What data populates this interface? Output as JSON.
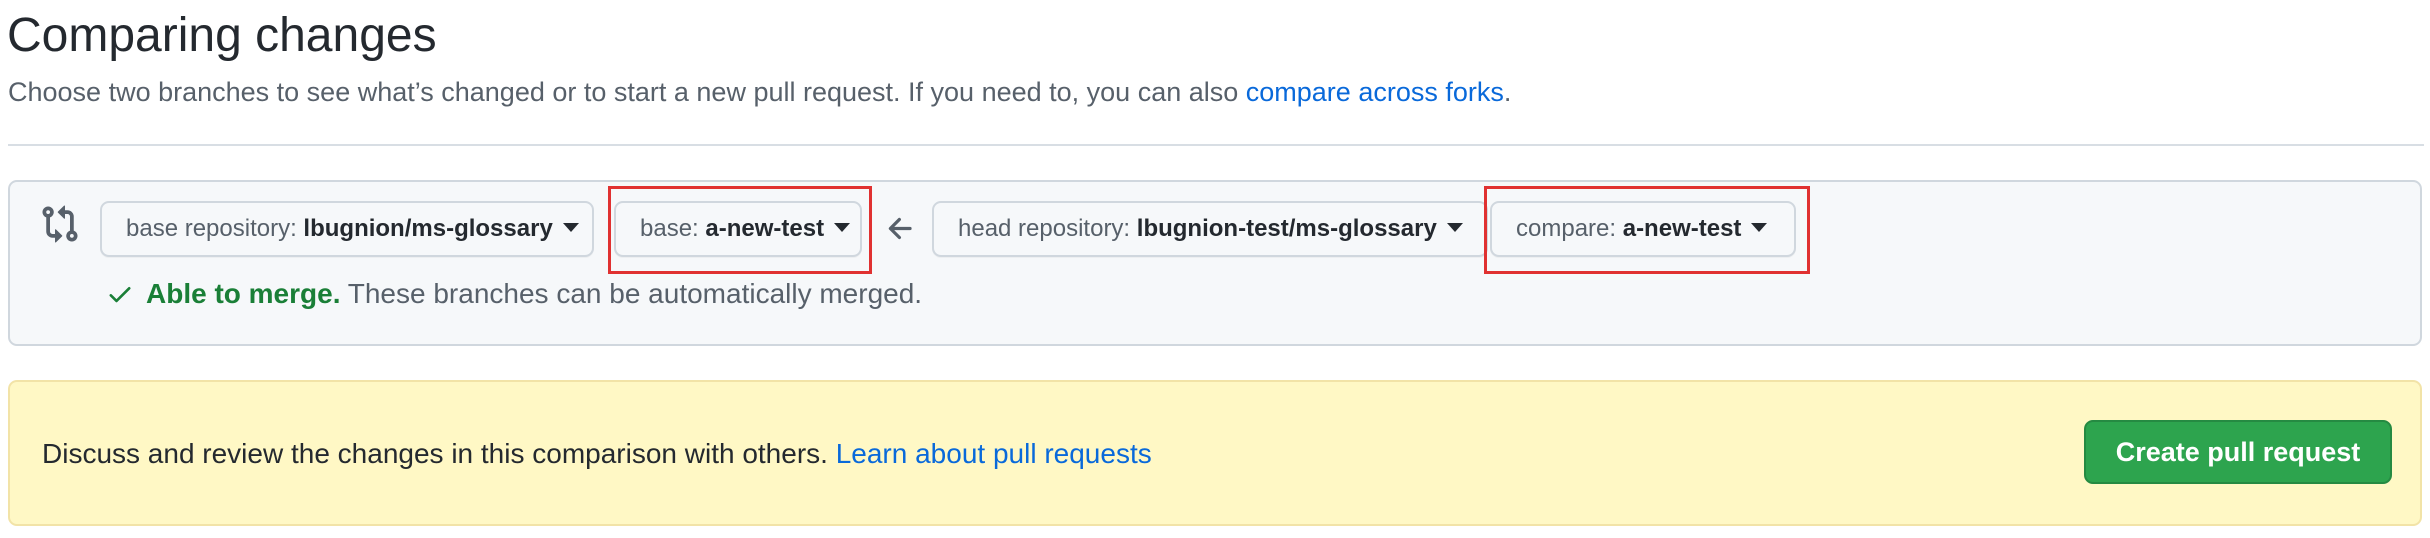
{
  "header": {
    "title": "Comparing changes",
    "subtitle_text": "Choose two branches to see what’s changed or to start a new pull request. If you need to, you can also ",
    "subtitle_link": "compare across forks",
    "subtitle_end": "."
  },
  "range": {
    "base_repo": {
      "label": "base repository: ",
      "value": "lbugnion/ms-glossary"
    },
    "base_branch": {
      "label": "base: ",
      "value": "a-new-test"
    },
    "head_repo": {
      "label": "head repository: ",
      "value": "lbugnion-test/ms-glossary"
    },
    "compare_branch": {
      "label": "compare: ",
      "value": "a-new-test"
    },
    "merge_ok": "Able to merge.",
    "merge_detail": " These branches can be automatically merged."
  },
  "flash": {
    "text": "Discuss and review the changes in this comparison with others. ",
    "link": "Learn about pull requests",
    "button": "Create pull request"
  },
  "colors": {
    "link": "#0969da",
    "success": "#1a7f37",
    "button_bg": "#2da44e",
    "flash_bg": "#fff8c5",
    "highlight": "#e03131"
  },
  "icons": [
    "git-compare-icon",
    "arrow-left-icon",
    "check-icon",
    "caret-down-icon"
  ]
}
